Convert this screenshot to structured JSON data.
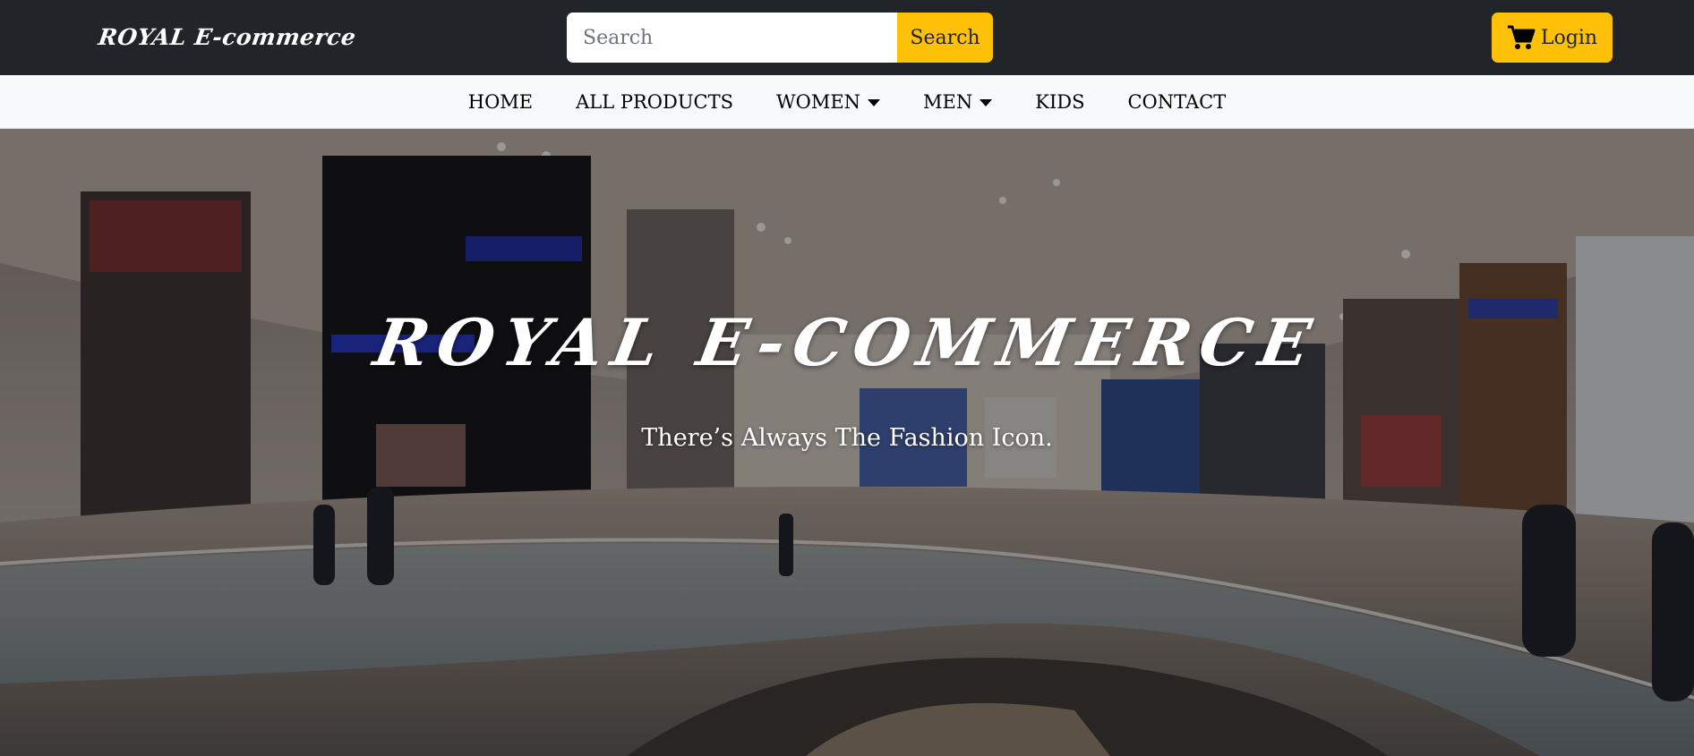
{
  "header": {
    "brand": "ROYAL E-commerce",
    "search": {
      "placeholder": "Search",
      "value": "",
      "button_label": "Search"
    },
    "login": {
      "label": "Login",
      "icon": "shopping-cart-icon"
    }
  },
  "nav": {
    "items": [
      {
        "label": "HOME",
        "dropdown": false
      },
      {
        "label": "ALL PRODUCTS",
        "dropdown": false
      },
      {
        "label": "WOMEN",
        "dropdown": true
      },
      {
        "label": "MEN",
        "dropdown": true
      },
      {
        "label": "KIDS",
        "dropdown": false
      },
      {
        "label": "CONTACT",
        "dropdown": false
      }
    ]
  },
  "hero": {
    "title": "ROYAL  E-COMMERCE",
    "subtitle": "There’s Always The Fashion Icon."
  },
  "colors": {
    "topbar_bg": "#212529",
    "accent": "#ffc107",
    "nav_bg": "#f8f9fa"
  }
}
